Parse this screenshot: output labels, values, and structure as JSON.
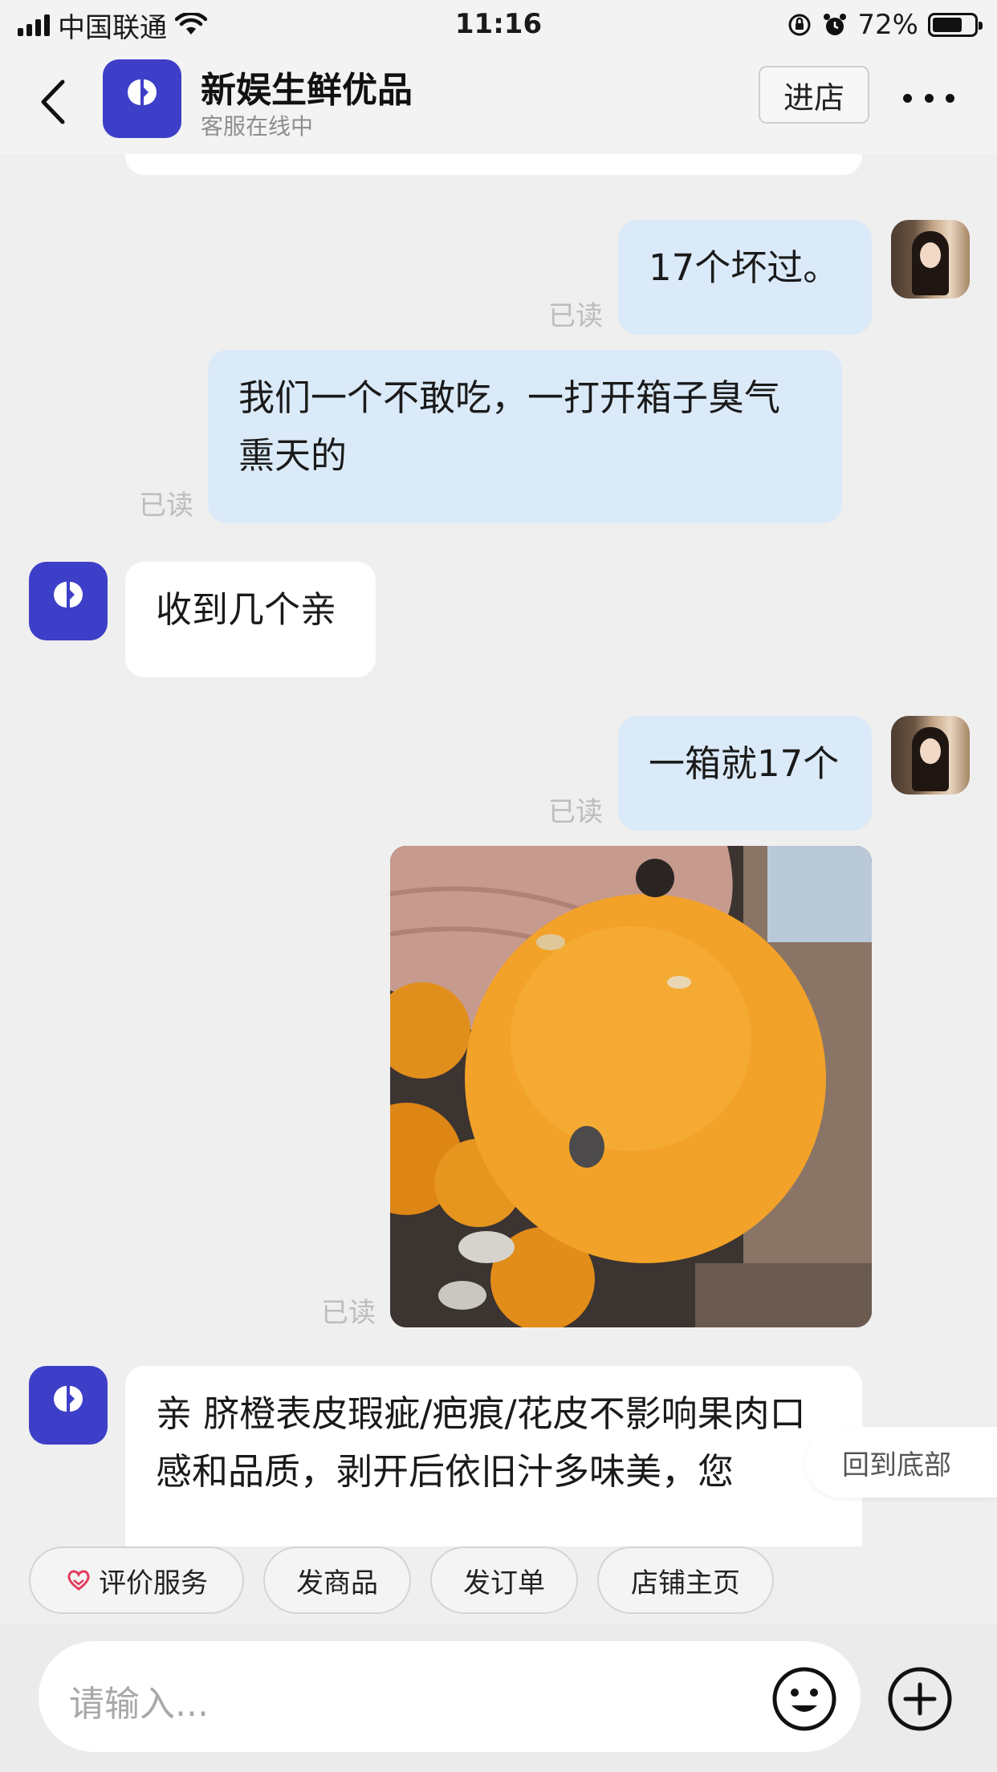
{
  "status_bar": {
    "carrier": "中国联通",
    "time": "11:16",
    "battery": "72%",
    "battery_level": 0.72
  },
  "header": {
    "shop_name": "新娱生鲜优品",
    "shop_status": "客服在线中",
    "enter_store": "进店"
  },
  "messages": {
    "m1": {
      "text": "17个坏过。",
      "read": "已读"
    },
    "m2": {
      "text": "我们一个不敢吃，一打开箱子臭气熏天的",
      "read": "已读"
    },
    "m3": {
      "text": "收到几个亲"
    },
    "m4": {
      "text": "一箱就17个",
      "read": "已读"
    },
    "m5": {
      "read": "已读"
    },
    "m6": {
      "text": "亲 脐橙表皮瑕疵/疤痕/花皮不影响果肉口感和品质，剥开后依旧汁多味美，您"
    }
  },
  "back_to_bottom": "回到底部",
  "quick_actions": [
    "评价服务",
    "发商品",
    "发订单",
    "店铺主页"
  ],
  "input": {
    "placeholder": "请输入..."
  },
  "icons": {
    "back": "chevron-left-icon",
    "more": "more-dots-icon",
    "emoji": "smile-icon",
    "plus": "plus-circle-icon",
    "rating": "heart-hands-icon"
  },
  "colors": {
    "my_bubble": "#dbeaf8",
    "their_bubble": "#ffffff",
    "brand": "#3e3fc8",
    "background": "#efefef"
  }
}
